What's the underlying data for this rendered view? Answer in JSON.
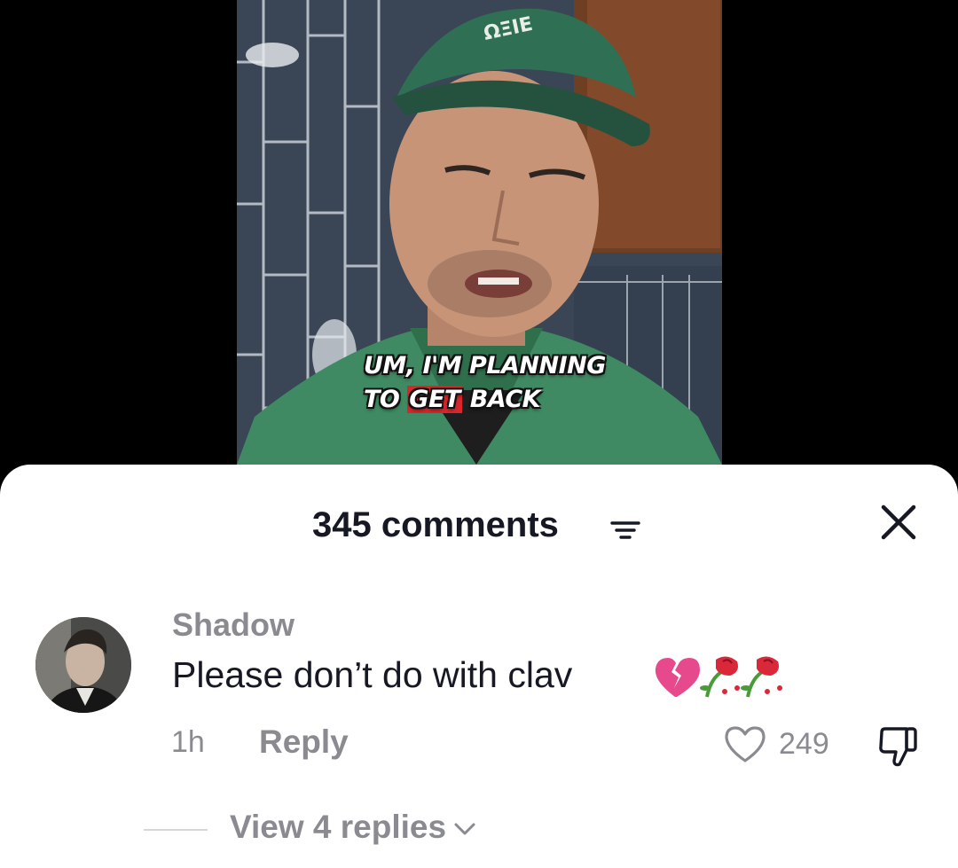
{
  "video": {
    "caption_line1": "UM, I'M PLANNING",
    "caption_line2_pre": "TO ",
    "caption_line2_hl": "GET",
    "caption_line2_post": " BACK"
  },
  "comments_panel": {
    "title": "345 comments",
    "filter_icon": "filter-icon",
    "close_icon": "close-icon"
  },
  "comment": {
    "username": "Shadow",
    "text": "Please don’t do with clav",
    "emojis": "💔🥀🥀",
    "timestamp": "1h",
    "reply_label": "Reply",
    "like_count": "249",
    "view_replies": "View 4 replies"
  },
  "colors": {
    "caption_highlight": "#d8262b",
    "primary_text": "#161823",
    "secondary_text": "#8a8b91"
  }
}
